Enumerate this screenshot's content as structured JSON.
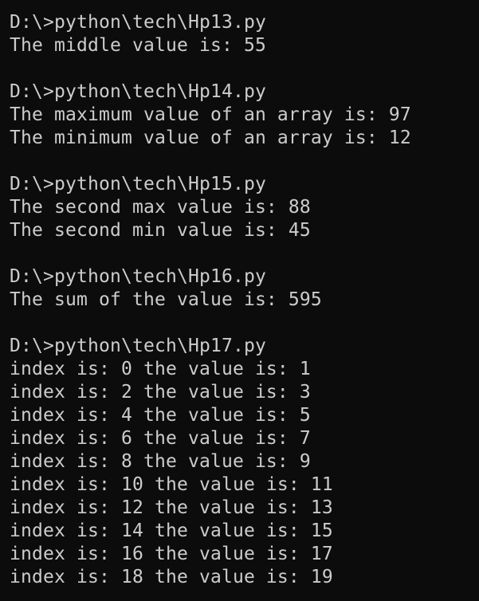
{
  "terminal": {
    "background": "#0c0c0c",
    "foreground": "#cccccc",
    "lines": [
      "D:\\>python\\tech\\Hp13.py",
      "The middle value is: 55",
      "",
      "D:\\>python\\tech\\Hp14.py",
      "The maximum value of an array is: 97",
      "The minimum value of an array is: 12",
      "",
      "D:\\>python\\tech\\Hp15.py",
      "The second max value is: 88",
      "The second min value is: 45",
      "",
      "D:\\>python\\tech\\Hp16.py",
      "The sum of the value is: 595",
      "",
      "D:\\>python\\tech\\Hp17.py",
      "index is: 0 the value is: 1",
      "index is: 2 the value is: 3",
      "index is: 4 the value is: 5",
      "index is: 6 the value is: 7",
      "index is: 8 the value is: 9",
      "index is: 10 the value is: 11",
      "index is: 12 the value is: 13",
      "index is: 14 the value is: 15",
      "index is: 16 the value is: 17",
      "index is: 18 the value is: 19"
    ]
  }
}
